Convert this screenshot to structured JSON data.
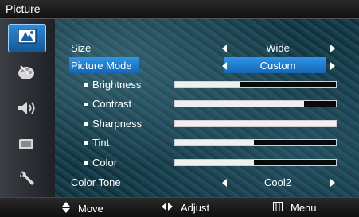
{
  "window": {
    "title": "Picture"
  },
  "sidebar": {
    "items": [
      {
        "name": "picture",
        "icon": "picture-icon",
        "selected": true
      },
      {
        "name": "color",
        "icon": "color-palette-icon",
        "selected": false
      },
      {
        "name": "sound",
        "icon": "speaker-icon",
        "selected": false
      },
      {
        "name": "channel",
        "icon": "tv-channel-icon",
        "selected": false
      },
      {
        "name": "setup",
        "icon": "wrench-icon",
        "selected": false
      }
    ]
  },
  "menu": {
    "size": {
      "label": "Size",
      "value": "Wide"
    },
    "picture_mode": {
      "label": "Picture Mode",
      "value": "Custom"
    },
    "sliders": [
      {
        "label": "Brightness",
        "level": 0.4
      },
      {
        "label": "Contrast",
        "level": 0.8
      },
      {
        "label": "Sharpness",
        "level": 1.0
      },
      {
        "label": "Tint",
        "level": 0.49
      },
      {
        "label": "Color",
        "level": 0.49
      }
    ],
    "color_tone": {
      "label": "Color Tone",
      "value": "Cool2"
    }
  },
  "footer": {
    "move": {
      "label": "Move",
      "icon": "up-down-arrows-icon"
    },
    "adjust": {
      "label": "Adjust",
      "icon": "left-right-arrows-icon"
    },
    "menu": {
      "label": "Menu",
      "icon": "menu-icon"
    }
  },
  "colors": {
    "highlight": "#1f7fd0",
    "titlebar": "#1a1a1a",
    "text": "#ffffff"
  }
}
